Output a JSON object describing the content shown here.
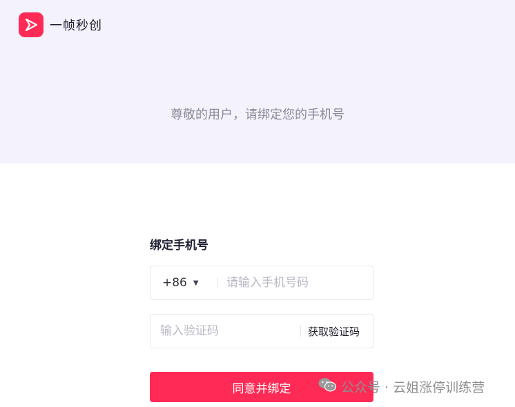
{
  "brand": {
    "name": "一帧秒创",
    "logo_color": "#ff2a55"
  },
  "header": {
    "greeting": "尊敬的用户，请绑定您的手机号"
  },
  "form": {
    "title": "绑定手机号",
    "country_code": "+86",
    "phone_placeholder": "请输入手机号码",
    "code_placeholder": "输入验证码",
    "get_code_label": "获取验证码",
    "submit_label": "同意并绑定"
  },
  "watermark": {
    "text": "公众号 · 云姐涨停训练营",
    "icon": "wechat-icon"
  },
  "colors": {
    "accent": "#ff2a55",
    "header_bg": "#f3f2fd"
  }
}
